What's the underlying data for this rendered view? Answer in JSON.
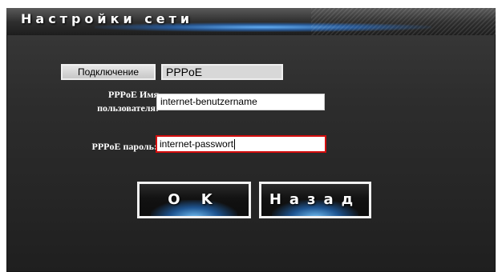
{
  "header": {
    "title": "Настройки сети"
  },
  "form": {
    "connection": {
      "label": "Подключение",
      "value": "PPPoE"
    },
    "username": {
      "label": "PPPoE Имя пользователя:",
      "value": "internet-benutzername"
    },
    "password": {
      "label": "PPPoE пароль:",
      "value": "internet-passwort"
    }
  },
  "buttons": {
    "ok_label": "O K",
    "back_label": "Назад"
  },
  "colors": {
    "panel_background": "#2b2b2b",
    "header_glow": "#3c8fe0",
    "focus_border": "#d40d0d",
    "text_light": "#ffffff"
  }
}
